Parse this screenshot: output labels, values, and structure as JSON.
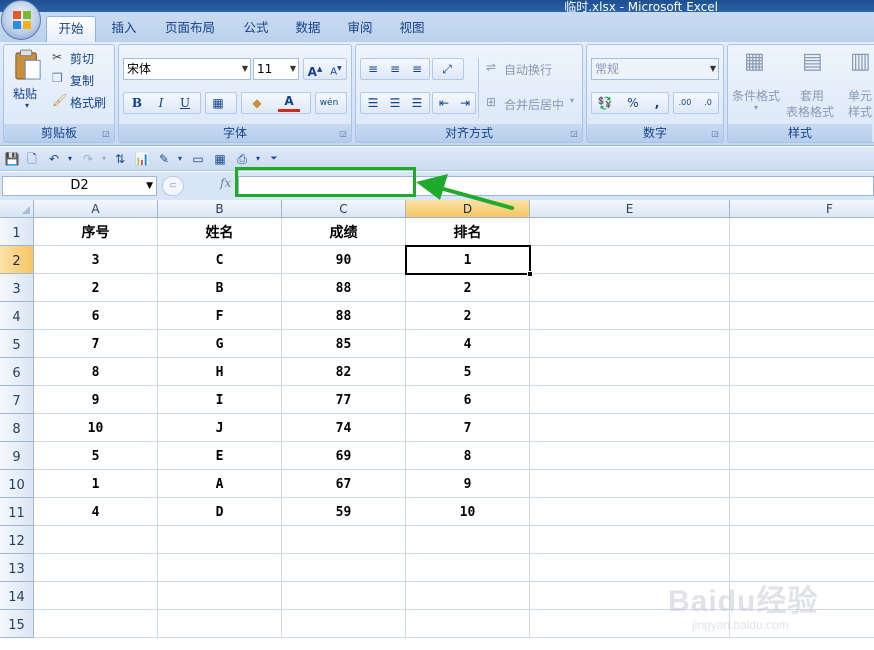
{
  "window": {
    "title": "临时.xlsx - Microsoft Excel"
  },
  "tabs": [
    {
      "label": "开始",
      "active": true
    },
    {
      "label": "插入"
    },
    {
      "label": "页面布局"
    },
    {
      "label": "公式"
    },
    {
      "label": "数据"
    },
    {
      "label": "审阅"
    },
    {
      "label": "视图"
    }
  ],
  "ribbon": {
    "clipboard": {
      "label": "剪贴板",
      "paste": "粘贴",
      "cut": "剪切",
      "copy": "复制",
      "format_painter": "格式刷"
    },
    "font": {
      "label": "字体",
      "name": "宋体",
      "size": "11",
      "bold": "B",
      "italic": "I",
      "underline": "U"
    },
    "alignment": {
      "label": "对齐方式",
      "wrap": "自动换行",
      "merge": "合并后居中"
    },
    "number": {
      "label": "数字",
      "format": "常规",
      "percent": "%"
    },
    "styles": {
      "label": "样式",
      "conditional": "条件格式",
      "table_format_top": "套用",
      "table_format": "表格格式",
      "cell_style_top": "单元",
      "cell_style": "样式"
    }
  },
  "formula_bar": {
    "name_box": "D2",
    "fx": "fx",
    "value": ""
  },
  "columns": [
    "A",
    "B",
    "C",
    "D",
    "E",
    "F"
  ],
  "rows": [
    "1",
    "2",
    "3",
    "4",
    "5",
    "6",
    "7",
    "8",
    "9",
    "10",
    "11",
    "12",
    "13",
    "14",
    "15"
  ],
  "table": {
    "header": [
      "序号",
      "姓名",
      "成绩",
      "排名"
    ],
    "body": [
      [
        "3",
        "C",
        "90",
        "1"
      ],
      [
        "2",
        "B",
        "88",
        "2"
      ],
      [
        "6",
        "F",
        "88",
        "2"
      ],
      [
        "7",
        "G",
        "85",
        "4"
      ],
      [
        "8",
        "H",
        "82",
        "5"
      ],
      [
        "9",
        "I",
        "77",
        "6"
      ],
      [
        "10",
        "J",
        "74",
        "7"
      ],
      [
        "5",
        "E",
        "69",
        "8"
      ],
      [
        "1",
        "A",
        "67",
        "9"
      ],
      [
        "4",
        "D",
        "59",
        "10"
      ]
    ]
  },
  "selection": {
    "cell": "D2",
    "column": "D",
    "row": "2"
  },
  "annotation": {
    "color": "#1faa2a"
  },
  "watermark": {
    "text": "Baidu经验",
    "sub": "jingyan.baidu.com"
  }
}
